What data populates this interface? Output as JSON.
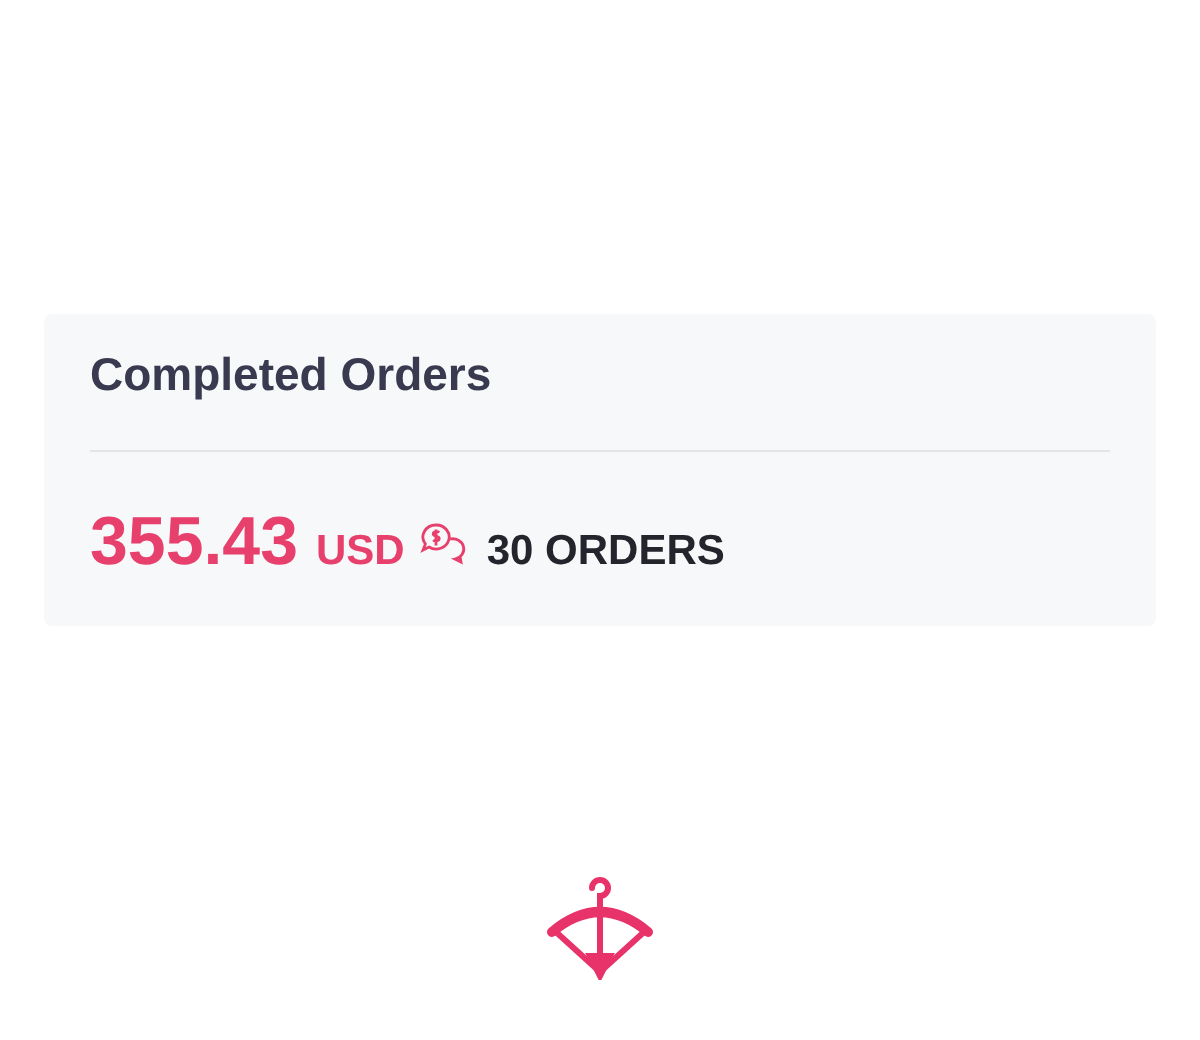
{
  "card": {
    "title": "Completed Orders",
    "amount": "355.43",
    "currency": "USD",
    "orders": "30 ORDERS"
  }
}
